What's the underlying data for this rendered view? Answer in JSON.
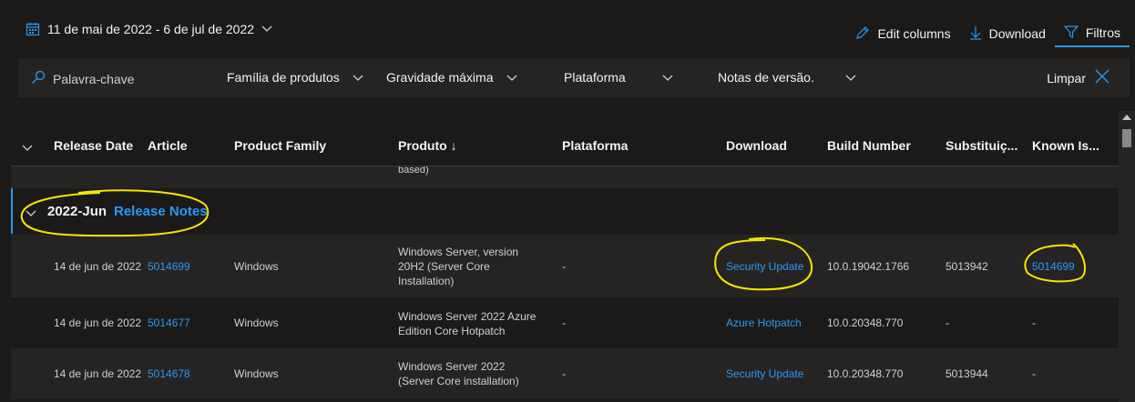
{
  "top": {
    "date_range": "11 de mai de 2022 - 6 de jul de 2022",
    "edit_columns": "Edit columns",
    "download": "Download",
    "filters": "Filtros"
  },
  "filters": {
    "search_placeholder": "Palavra-chave",
    "product_family": "Família de produtos",
    "max_severity": "Gravidade máxima",
    "platform": "Plataforma",
    "release_notes": "Notas de versão.",
    "clear": "Limpar"
  },
  "columns": [
    "Release Date",
    "Article",
    "Product Family",
    "Produto",
    "Plataforma",
    "Download",
    "Build Number",
    "Substituiç...",
    "Known Is..."
  ],
  "sort_indicator": "↓",
  "partial_row": {
    "product": "based)"
  },
  "group": {
    "title": "2022-Jun",
    "link": "Release Notes"
  },
  "rows": [
    {
      "date": "14 de jun de 2022",
      "article": "5014699",
      "family": "Windows",
      "product": "Windows Server, version 20H2 (Server Core Installation)",
      "platform": "-",
      "download": "Security Update",
      "build": "10.0.19042.1766",
      "supersedes": "5013942",
      "known": "5014699"
    },
    {
      "date": "14 de jun de 2022",
      "article": "5014677",
      "family": "Windows",
      "product": "Windows Server 2022 Azure Edition Core Hotpatch",
      "platform": "-",
      "download": "Azure Hotpatch",
      "build": "10.0.20348.770",
      "supersedes": "-",
      "known": "-"
    },
    {
      "date": "14 de jun de 2022",
      "article": "5014678",
      "family": "Windows",
      "product": "Windows Server 2022 (Server Core installation)",
      "platform": "-",
      "download": "Security Update",
      "build": "10.0.20348.770",
      "supersedes": "5013944",
      "known": "-"
    }
  ],
  "colors": {
    "accent": "#2899f5",
    "background": "#1b1a19",
    "row_alt": "#252423",
    "annotation": "#f6e600"
  }
}
